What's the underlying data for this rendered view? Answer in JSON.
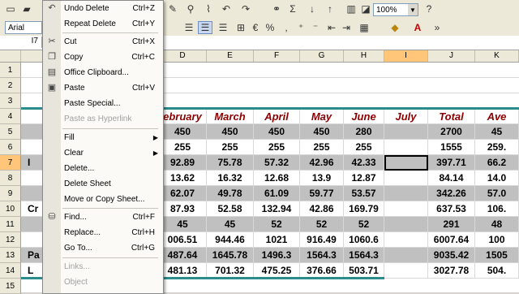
{
  "toolbar": {
    "font_name": "Arial",
    "zoom": "100%",
    "sum_symbol": "Σ",
    "percent_symbol": "%",
    "comma_symbol": ",",
    "help_symbol": "?",
    "font_color_symbol": "A"
  },
  "formula_bar": {
    "name_box": "I7"
  },
  "columns": [
    "D",
    "E",
    "F",
    "G",
    "H",
    "I",
    "J",
    "K"
  ],
  "selected_column": "I",
  "rows": [
    "1",
    "2",
    "3",
    "4",
    "5",
    "6",
    "7",
    "8",
    "9",
    "10",
    "11",
    "12",
    "13",
    "14",
    "15"
  ],
  "selected_row": "7",
  "sheet": {
    "header": [
      "ebruary",
      "March",
      "April",
      "May",
      "June",
      "July",
      "Total",
      "Ave"
    ],
    "data": [
      [
        "450",
        "450",
        "450",
        "450",
        "280",
        "",
        "2700",
        "45"
      ],
      [
        "255",
        "255",
        "255",
        "255",
        "255",
        "",
        "1555",
        "259."
      ],
      [
        "92.89",
        "75.78",
        "57.32",
        "42.96",
        "42.33",
        "",
        "397.71",
        "66.2"
      ],
      [
        "13.62",
        "16.32",
        "12.68",
        "13.9",
        "12.87",
        "",
        "84.14",
        "14.0"
      ],
      [
        "62.07",
        "49.78",
        "61.09",
        "59.77",
        "53.57",
        "",
        "342.26",
        "57.0"
      ],
      [
        "87.93",
        "52.58",
        "132.94",
        "42.86",
        "169.79",
        "",
        "637.53",
        "106."
      ],
      [
        "45",
        "45",
        "52",
        "52",
        "52",
        "",
        "291",
        "48"
      ],
      [
        "006.51",
        "944.46",
        "1021",
        "916.49",
        "1060.6",
        "",
        "6007.64",
        "100"
      ],
      [
        "487.64",
        "1645.78",
        "1496.3",
        "1564.3",
        "1564.3",
        "",
        "9035.42",
        "1505"
      ],
      [
        "481.13",
        "701.32",
        "475.25",
        "376.66",
        "503.71",
        "",
        "3027.78",
        "504."
      ]
    ],
    "row_label_fragments": {
      "7": "I",
      "10": "Cr",
      "13": "Pa",
      "14": "L"
    }
  },
  "context_menu": {
    "items": [
      {
        "label": "Undo Delete",
        "shortcut": "Ctrl+Z",
        "icon": "undo-icon",
        "enabled": true
      },
      {
        "label": "Repeat Delete",
        "shortcut": "Ctrl+Y",
        "icon": "",
        "enabled": true
      },
      {
        "label": "Cut",
        "shortcut": "Ctrl+X",
        "icon": "scissors-icon",
        "enabled": true
      },
      {
        "label": "Copy",
        "shortcut": "Ctrl+C",
        "icon": "copy-icon",
        "enabled": true
      },
      {
        "label": "Office Clipboard...",
        "shortcut": "",
        "icon": "clipboard-icon",
        "enabled": true
      },
      {
        "label": "Paste",
        "shortcut": "Ctrl+V",
        "icon": "paste-icon",
        "enabled": true
      },
      {
        "label": "Paste Special...",
        "shortcut": "",
        "icon": "",
        "enabled": true
      },
      {
        "label": "Paste as Hyperlink",
        "shortcut": "",
        "icon": "",
        "enabled": false
      },
      {
        "label": "Fill",
        "shortcut": "",
        "icon": "",
        "enabled": true,
        "submenu": true
      },
      {
        "label": "Clear",
        "shortcut": "",
        "icon": "",
        "enabled": true,
        "submenu": true
      },
      {
        "label": "Delete...",
        "shortcut": "",
        "icon": "",
        "enabled": true
      },
      {
        "label": "Delete Sheet",
        "shortcut": "",
        "icon": "",
        "enabled": true
      },
      {
        "label": "Move or Copy Sheet...",
        "shortcut": "",
        "icon": "",
        "enabled": true
      },
      {
        "label": "Find...",
        "shortcut": "Ctrl+F",
        "icon": "binoculars-icon",
        "enabled": true
      },
      {
        "label": "Replace...",
        "shortcut": "Ctrl+H",
        "icon": "",
        "enabled": true
      },
      {
        "label": "Go To...",
        "shortcut": "Ctrl+G",
        "icon": "",
        "enabled": true
      },
      {
        "label": "Links...",
        "shortcut": "",
        "icon": "",
        "enabled": false
      },
      {
        "label": "Object",
        "shortcut": "",
        "icon": "",
        "enabled": false
      }
    ]
  },
  "colors": {
    "header_text": "#8b0000",
    "row_band": "#c0c0c0",
    "accent_line": "#2a8c8c",
    "selection": "#ffc67a"
  }
}
